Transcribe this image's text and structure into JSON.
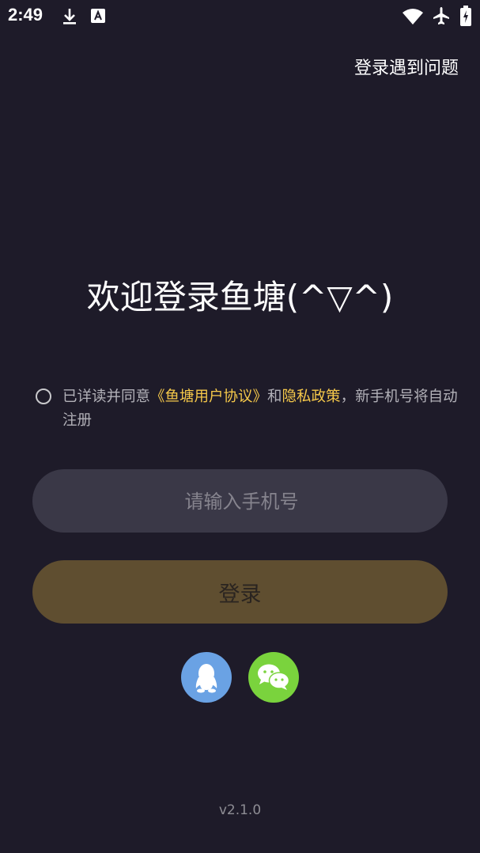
{
  "status_bar": {
    "time": "2:49",
    "left_icons": [
      "download-icon",
      "a-badge-icon"
    ],
    "right_icons": [
      "wifi-icon",
      "airplane-icon",
      "battery-icon"
    ]
  },
  "header": {
    "help_link": "登录遇到问题"
  },
  "main": {
    "welcome_title": "欢迎登录鱼塘(^▽^)",
    "agreement": {
      "prefix": "已详读并同意",
      "user_agreement": "《鱼塘用户协议》",
      "and": "和",
      "privacy_policy": "隐私政策",
      "suffix": "，新手机号将自动注册",
      "checked": false
    },
    "phone_input": {
      "placeholder": "请输入手机号",
      "value": ""
    },
    "login_button": "登录",
    "social_logins": [
      {
        "name": "qq-icon",
        "color": "#6aa2e4"
      },
      {
        "name": "wechat-icon",
        "color": "#7ad33d"
      }
    ]
  },
  "footer": {
    "version": "v2.1.0"
  },
  "colors": {
    "background": "#1e1b29",
    "accent": "#f5c84a",
    "input_bg": "#3a3847",
    "button_bg": "#5f4e30"
  }
}
